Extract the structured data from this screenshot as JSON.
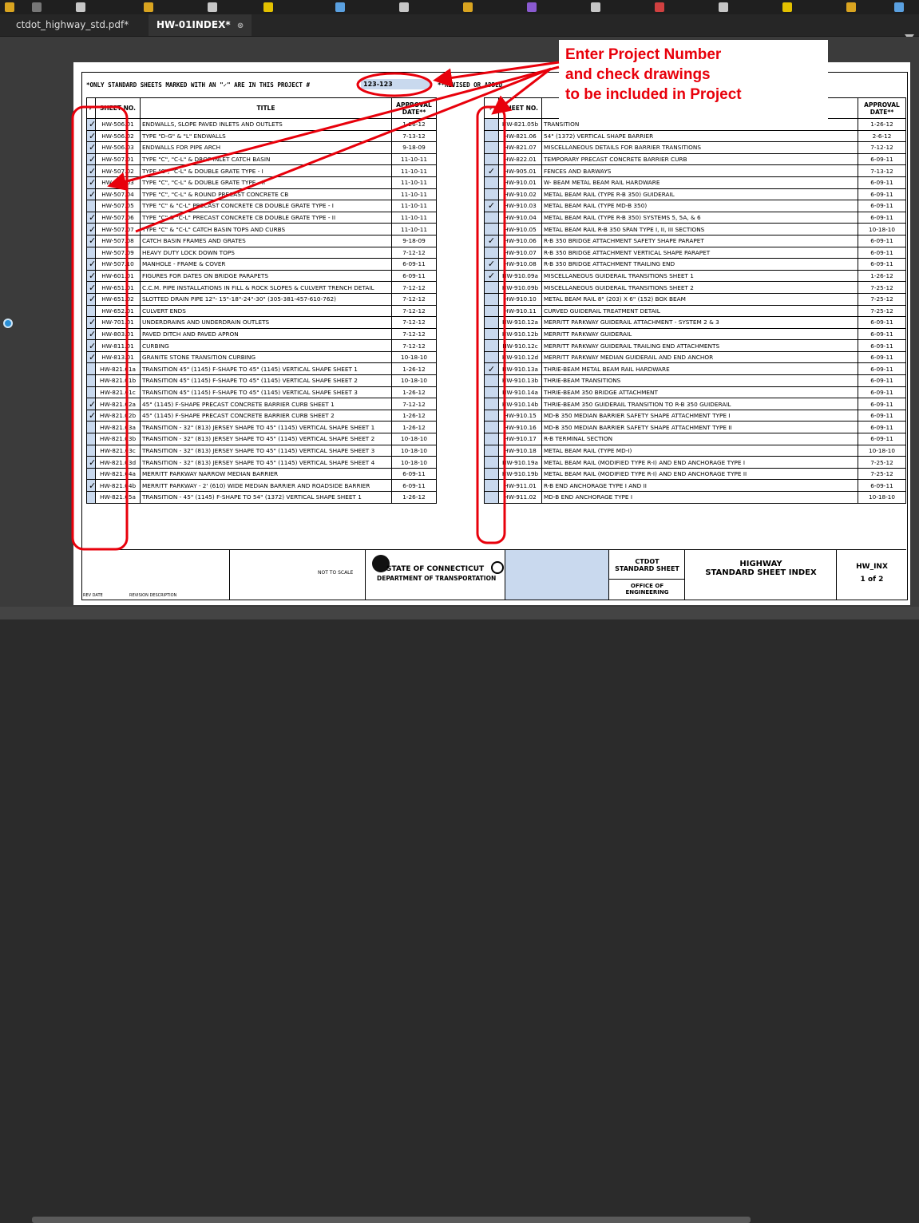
{
  "tabs": [
    {
      "label": "ctdot_highway_std.pdf*"
    },
    {
      "label": "HW-01INDEX*",
      "close": "⊗"
    }
  ],
  "header": {
    "note": "*ONLY STANDARD SHEETS MARKED WITH AN \"✓\" ARE IN THIS PROJECT #",
    "project_number": "123-123",
    "note2": "**REVISED OR ADDED"
  },
  "annotation": {
    "line1": "Enter Project Number",
    "line2": "and check drawings",
    "line3": "to be included in Project"
  },
  "columns": {
    "check": "✓",
    "sheet": "SHEET NO.",
    "title": "TITLE",
    "date": "APPROVAL DATE**"
  },
  "left_rows": [
    {
      "check": "✓",
      "sheet": "HW-506.01",
      "title": "ENDWALLS, SLOPE PAVED INLETS AND OUTLETS",
      "date": "1-26-12"
    },
    {
      "check": "✓",
      "sheet": "HW-506.02",
      "title": "TYPE \"D-G\" & \"L\" ENDWALLS",
      "date": "7-13-12"
    },
    {
      "check": "✓",
      "sheet": "HW-506.03",
      "title": "ENDWALLS FOR PIPE ARCH",
      "date": "9-18-09"
    },
    {
      "check": "✓",
      "sheet": "HW-507.01",
      "title": "TYPE \"C\", \"C-L\" & DROP INLET CATCH BASIN",
      "date": "11-10-11"
    },
    {
      "check": "✓",
      "sheet": "HW-507.02",
      "title": "TYPE \"C\", \"C-L\" & DOUBLE GRATE TYPE - I",
      "date": "11-10-11"
    },
    {
      "check": "✓",
      "sheet": "HW-507.03",
      "title": "TYPE \"C\", \"C-L\" & DOUBLE GRATE TYPE - II",
      "date": "11-10-11"
    },
    {
      "check": "✓",
      "sheet": "HW-507.04",
      "title": "TYPE \"C\", \"C-L\" & ROUND PRECAST CONCRETE CB",
      "date": "11-10-11"
    },
    {
      "check": "",
      "sheet": "HW-507.05",
      "title": "TYPE \"C\" & \"C-L\" PRECAST CONCRETE CB DOUBLE GRATE TYPE - I",
      "date": "11-10-11"
    },
    {
      "check": "✓",
      "sheet": "HW-507.06",
      "title": "TYPE \"C\" & \"C-L\" PRECAST CONCRETE CB DOUBLE GRATE TYPE - II",
      "date": "11-10-11"
    },
    {
      "check": "✓",
      "sheet": "HW-507.07",
      "title": "TYPE \"C\" & \"C-L\" CATCH BASIN TOPS AND CURBS",
      "date": "11-10-11"
    },
    {
      "check": "✓",
      "sheet": "HW-507.08",
      "title": "CATCH BASIN FRAMES AND GRATES",
      "date": "9-18-09"
    },
    {
      "check": "",
      "sheet": "HW-507.09",
      "title": "HEAVY DUTY LOCK DOWN TOPS",
      "date": "7-12-12"
    },
    {
      "check": "✓",
      "sheet": "HW-507.10",
      "title": "MANHOLE - FRAME & COVER",
      "date": "6-09-11"
    },
    {
      "check": "✓",
      "sheet": "HW-601.01",
      "title": "FIGURES FOR DATES ON BRIDGE PARAPETS",
      "date": "6-09-11"
    },
    {
      "check": "✓",
      "sheet": "HW-651.01",
      "title": "C.C.M. PIPE INSTALLATIONS IN FILL & ROCK SLOPES & CULVERT TRENCH DETAIL",
      "date": "7-12-12"
    },
    {
      "check": "✓",
      "sheet": "HW-651.02",
      "title": "SLOTTED DRAIN PIPE 12\"- 15\"-18\"-24\"-30\" (305-381-457-610-762)",
      "date": "7-12-12"
    },
    {
      "check": "",
      "sheet": "HW-652.01",
      "title": "CULVERT ENDS",
      "date": "7-12-12"
    },
    {
      "check": "✓",
      "sheet": "HW-701.01",
      "title": "UNDERDRAINS AND UNDERDRAIN OUTLETS",
      "date": "7-12-12"
    },
    {
      "check": "✓",
      "sheet": "HW-803.01",
      "title": "PAVED DITCH AND PAVED APRON",
      "date": "7-12-12"
    },
    {
      "check": "✓",
      "sheet": "HW-811.01",
      "title": "CURBING",
      "date": "7-12-12"
    },
    {
      "check": "✓",
      "sheet": "HW-813.01",
      "title": "GRANITE STONE TRANSITION CURBING",
      "date": "10-18-10"
    },
    {
      "check": "",
      "sheet": "HW-821.01a",
      "title": "TRANSITION 45\" (1145) F-SHAPE TO 45\" (1145) VERTICAL SHAPE SHEET 1",
      "date": "1-26-12"
    },
    {
      "check": "",
      "sheet": "HW-821.01b",
      "title": "TRANSITION 45\" (1145) F-SHAPE TO 45\" (1145) VERTICAL SHAPE SHEET 2",
      "date": "10-18-10"
    },
    {
      "check": "",
      "sheet": "HW-821.01c",
      "title": "TRANSITION 45\" (1145) F-SHAPE TO 45\" (1145) VERTICAL SHAPE SHEET 3",
      "date": "1-26-12"
    },
    {
      "check": "✓",
      "sheet": "HW-821.02a",
      "title": "45\" (1145) F-SHAPE PRECAST CONCRETE BARRIER CURB SHEET 1",
      "date": "7-12-12"
    },
    {
      "check": "✓",
      "sheet": "HW-821.02b",
      "title": "45\" (1145) F-SHAPE PRECAST CONCRETE BARRIER CURB SHEET 2",
      "date": "1-26-12"
    },
    {
      "check": "",
      "sheet": "HW-821.03a",
      "title": "TRANSITION - 32\" (813) JERSEY SHAPE TO 45\" (1145) VERTICAL SHAPE SHEET 1",
      "date": "1-26-12"
    },
    {
      "check": "",
      "sheet": "HW-821.03b",
      "title": "TRANSITION - 32\" (813) JERSEY SHAPE TO 45\" (1145) VERTICAL SHAPE SHEET 2",
      "date": "10-18-10"
    },
    {
      "check": "",
      "sheet": "HW-821.03c",
      "title": "TRANSITION - 32\" (813) JERSEY SHAPE TO 45\" (1145) VERTICAL SHAPE SHEET 3",
      "date": "10-18-10"
    },
    {
      "check": "✓",
      "sheet": "HW-821.03d",
      "title": "TRANSITION - 32\" (813) JERSEY SHAPE TO 45\" (1145) VERTICAL SHAPE SHEET 4",
      "date": "10-18-10"
    },
    {
      "check": "",
      "sheet": "HW-821.04a",
      "title": "MERRITT PARKWAY NARROW MEDIAN BARRIER",
      "date": "6-09-11"
    },
    {
      "check": "✓",
      "sheet": "HW-821.04b",
      "title": "MERRITT PARKWAY - 2' (610) WIDE MEDIAN BARRIER AND ROADSIDE BARRIER",
      "date": "6-09-11"
    },
    {
      "check": "",
      "sheet": "HW-821.05a",
      "title": "TRANSITION - 45\" (1145) F-SHAPE TO 54\" (1372) VERTICAL SHAPE SHEET 1",
      "date": "1-26-12"
    }
  ],
  "right_rows": [
    {
      "check": "",
      "sheet": "HW-821.05b",
      "title": "TRANSITION",
      "date": "1-26-12"
    },
    {
      "check": "",
      "sheet": "HW-821.06",
      "title": "54\" (1372) VERTICAL SHAPE BARRIER",
      "date": "2-6-12"
    },
    {
      "check": "",
      "sheet": "HW-821.07",
      "title": "MISCELLANEOUS DETAILS FOR BARRIER TRANSITIONS",
      "date": "7-12-12"
    },
    {
      "check": "",
      "sheet": "HW-822.01",
      "title": "TEMPORARY PRECAST CONCRETE BARRIER CURB",
      "date": "6-09-11"
    },
    {
      "check": "✓",
      "sheet": "HW-905.01",
      "title": "FENCES AND BARWAYS",
      "date": "7-13-12"
    },
    {
      "check": "",
      "sheet": "HW-910.01",
      "title": "W- BEAM METAL BEAM RAIL HARDWARE",
      "date": "6-09-11"
    },
    {
      "check": "",
      "sheet": "HW-910.02",
      "title": "METAL BEAM RAIL (TYPE R-B 350) GUIDERAIL",
      "date": "6-09-11"
    },
    {
      "check": "✓",
      "sheet": "HW-910.03",
      "title": "METAL BEAM RAIL (TYPE MD-B 350)",
      "date": "6-09-11"
    },
    {
      "check": "",
      "sheet": "HW-910.04",
      "title": "METAL BEAM RAIL (TYPE R-B 350) SYSTEMS 5, 5A, & 6",
      "date": "6-09-11"
    },
    {
      "check": "",
      "sheet": "HW-910.05",
      "title": "METAL BEAM RAIL R-B 350 SPAN TYPE I, II, III SECTIONS",
      "date": "10-18-10"
    },
    {
      "check": "✓",
      "sheet": "HW-910.06",
      "title": "R-B 350 BRIDGE ATTACHMENT SAFETY SHAPE PARAPET",
      "date": "6-09-11"
    },
    {
      "check": "",
      "sheet": "HW-910.07",
      "title": "R-B 350 BRIDGE ATTACHMENT VERTICAL SHAPE PARAPET",
      "date": "6-09-11"
    },
    {
      "check": "✓",
      "sheet": "HW-910.08",
      "title": "R-B 350 BRIDGE ATTACHMENT TRAILING END",
      "date": "6-09-11"
    },
    {
      "check": "✓",
      "sheet": "HW-910.09a",
      "title": "MISCELLANEOUS GUIDERAIL TRANSITIONS SHEET 1",
      "date": "1-26-12"
    },
    {
      "check": "",
      "sheet": "HW-910.09b",
      "title": "MISCELLANEOUS GUIDERAIL TRANSITIONS SHEET 2",
      "date": "7-25-12"
    },
    {
      "check": "",
      "sheet": "HW-910.10",
      "title": "METAL BEAM RAIL 8\" (203) X 6\" (152) BOX BEAM",
      "date": "7-25-12"
    },
    {
      "check": "",
      "sheet": "HW-910.11",
      "title": "CURVED GUIDERAIL TREATMENT DETAIL",
      "date": "7-25-12"
    },
    {
      "check": "",
      "sheet": "HW-910.12a",
      "title": "MERRITT PARKWAY GUIDERAIL ATTACHMENT - SYSTEM 2 & 3",
      "date": "6-09-11"
    },
    {
      "check": "",
      "sheet": "HW-910.12b",
      "title": "MERRITT PARKWAY GUIDERAIL",
      "date": "6-09-11"
    },
    {
      "check": "",
      "sheet": "HW-910.12c",
      "title": "MERRITT PARKWAY GUIDERAIL TRAILING END ATTACHMENTS",
      "date": "6-09-11"
    },
    {
      "check": "",
      "sheet": "HW-910.12d",
      "title": "MERRITT PARKWAY MEDIAN GUIDERAIL AND END ANCHOR",
      "date": "6-09-11"
    },
    {
      "check": "✓",
      "sheet": "HW-910.13a",
      "title": "THRIE-BEAM METAL BEAM RAIL HARDWARE",
      "date": "6-09-11"
    },
    {
      "check": "",
      "sheet": "HW-910.13b",
      "title": "THRIE-BEAM TRANSITIONS",
      "date": "6-09-11"
    },
    {
      "check": "",
      "sheet": "HW-910.14a",
      "title": "THRIE-BEAM 350 BRIDGE ATTACHMENT",
      "date": "6-09-11"
    },
    {
      "check": "",
      "sheet": "HW-910.14b",
      "title": "THRIE-BEAM 350 GUIDERAIL TRANSITION TO R-B 350 GUIDERAIL",
      "date": "6-09-11"
    },
    {
      "check": "",
      "sheet": "HW-910.15",
      "title": "MD-B 350 MEDIAN BARRIER SAFETY SHAPE ATTACHMENT TYPE I",
      "date": "6-09-11"
    },
    {
      "check": "",
      "sheet": "HW-910.16",
      "title": "MD-B 350 MEDIAN BARRIER SAFETY SHAPE ATTACHMENT TYPE II",
      "date": "6-09-11"
    },
    {
      "check": "",
      "sheet": "HW-910.17",
      "title": "R-B TERMINAL SECTION",
      "date": "6-09-11"
    },
    {
      "check": "",
      "sheet": "HW-910.18",
      "title": "METAL BEAM RAIL (TYPE MD-I)",
      "date": "10-18-10"
    },
    {
      "check": "",
      "sheet": "HW-910.19a",
      "title": "METAL BEAM RAIL (MODIFIED TYPE R-I) AND END ANCHORAGE TYPE I",
      "date": "7-25-12"
    },
    {
      "check": "",
      "sheet": "HW-910.19b",
      "title": "METAL BEAM RAIL (MODIFIED TYPE R-I) AND END ANCHORAGE TYPE II",
      "date": "7-25-12"
    },
    {
      "check": "",
      "sheet": "HW-911.01",
      "title": "R-B END ANCHORAGE TYPE I AND II",
      "date": "6-09-11"
    },
    {
      "check": "",
      "sheet": "HW-911.02",
      "title": "MD-B END ANCHORAGE TYPE I",
      "date": "10-18-10"
    }
  ],
  "title_block": {
    "rev_date": "REV DATE",
    "rev_desc": "REVISION DESCRIPTION",
    "scale": "NOT TO SCALE",
    "state": "STATE OF CONNECTICUT",
    "dept": "DEPARTMENT OF TRANSPORTATION",
    "ctdot": "CTDOT",
    "std_sheet": "STANDARD SHEET",
    "office": "OFFICE OF ENGINEERING",
    "sheet_title1": "HIGHWAY",
    "sheet_title2": "STANDARD SHEET INDEX",
    "sheet_no": "HW_INX",
    "page": "1 of 2"
  },
  "colors": {
    "accent_red": "#e8000b",
    "check_fill": "#c9d9ee"
  }
}
